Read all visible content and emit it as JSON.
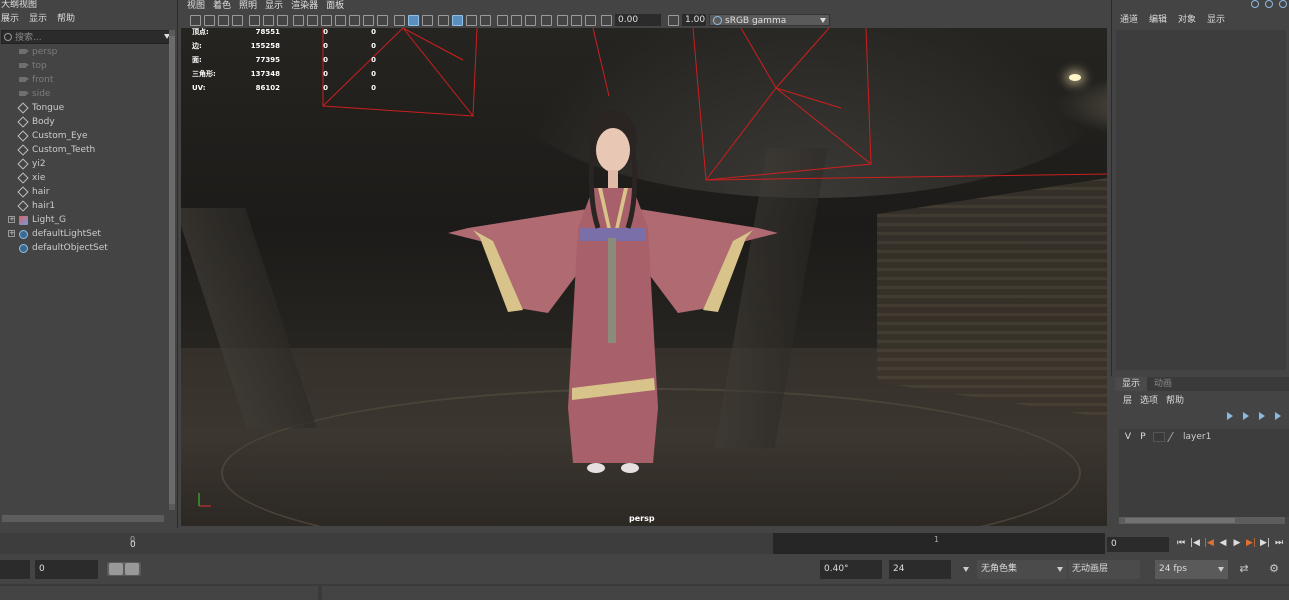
{
  "outliner": {
    "title": "大纲视图",
    "menu": [
      "展示",
      "显示",
      "帮助"
    ],
    "search_placeholder": "搜索...",
    "items": [
      {
        "label": "persp",
        "type": "camera",
        "dim": true
      },
      {
        "label": "top",
        "type": "camera",
        "dim": true
      },
      {
        "label": "front",
        "type": "camera",
        "dim": true
      },
      {
        "label": "side",
        "type": "camera",
        "dim": true
      },
      {
        "label": "Tongue",
        "type": "mesh"
      },
      {
        "label": "Body",
        "type": "mesh"
      },
      {
        "label": "Custom_Eye",
        "type": "mesh"
      },
      {
        "label": "Custom_Teeth",
        "type": "mesh"
      },
      {
        "label": "yi2",
        "type": "mesh"
      },
      {
        "label": "xie",
        "type": "mesh"
      },
      {
        "label": "hair",
        "type": "mesh"
      },
      {
        "label": "hair1",
        "type": "mesh"
      },
      {
        "label": "Light_G",
        "type": "light",
        "expandable": true
      },
      {
        "label": "defaultLightSet",
        "type": "set",
        "expandable": true
      },
      {
        "label": "defaultObjectSet",
        "type": "set"
      }
    ]
  },
  "viewport": {
    "menu": [
      "视图",
      "着色",
      "照明",
      "显示",
      "渲染器",
      "面板"
    ],
    "toolbar": {
      "exposure": "0.00",
      "gamma": "1.00",
      "color_space": "sRGB gamma"
    },
    "hud": [
      {
        "label": "顶点:",
        "v1": "78551",
        "v2": "0",
        "v3": "0"
      },
      {
        "label": "边:",
        "v1": "155258",
        "v2": "0",
        "v3": "0"
      },
      {
        "label": "面:",
        "v1": "77395",
        "v2": "0",
        "v3": "0"
      },
      {
        "label": "三角形:",
        "v1": "137348",
        "v2": "0",
        "v3": "0"
      },
      {
        "label": "UV:",
        "v1": "86102",
        "v2": "0",
        "v3": "0"
      }
    ],
    "camera_label": "persp",
    "axis_labels": {
      "y": "y",
      "x": "x"
    }
  },
  "channel_box": {
    "menu": [
      "通道",
      "编辑",
      "对象",
      "显示"
    ]
  },
  "layer_editor": {
    "tabs": [
      "显示",
      "动画"
    ],
    "menu": [
      "层",
      "选项",
      "帮助"
    ],
    "layers": [
      {
        "v": "V",
        "p": "P",
        "name": "layer1"
      }
    ]
  },
  "time_slider": {
    "start_tick": "0",
    "mid_tick": "1",
    "current_frame": "0",
    "frame_field": "0"
  },
  "range_slider": {
    "start_field": "0",
    "rotation_field": "0.40°",
    "end_field": "24",
    "character_set": "无角色集",
    "anim_layer": "无动画层",
    "fps": "24 fps"
  },
  "colors": {
    "wireframe": "#cc1f1f",
    "accent": "#5b8fc0",
    "panel_bg": "#444444"
  }
}
